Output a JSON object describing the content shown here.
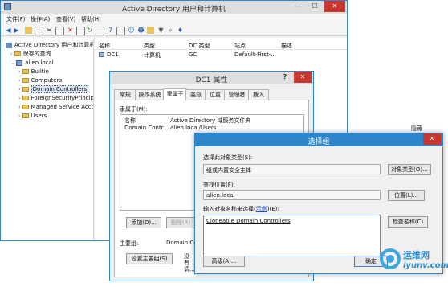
{
  "main": {
    "title": "Active Directory 用户和计算机",
    "menu": [
      "文件(F)",
      "操作(A)",
      "查看(V)",
      "帮助(H)"
    ],
    "tree": {
      "root": "Active Directory 用户和计算机",
      "saved": "保存的查询",
      "domain": "alien.local",
      "children": [
        "Builtin",
        "Computers",
        "Domain Controllers",
        "ForeignSecurityPrincipa",
        "Managed Service Acco",
        "Users"
      ]
    },
    "list": {
      "headers": [
        "名称",
        "类型",
        "DC 类型",
        "站点",
        "描述"
      ],
      "rows": [
        [
          "DC1",
          "计算机",
          "GC",
          "Default-First-...",
          ""
        ]
      ]
    },
    "side_text": "隐藏"
  },
  "props": {
    "title": "DC1 属性",
    "help": "?",
    "tabs": [
      "常规",
      "操作系统",
      "隶属于",
      "委派",
      "位置",
      "管理者",
      "拨入"
    ],
    "member_of_label": "隶属于(M):",
    "table_headers": [
      "名称",
      "Active Directory 域服务文件夹"
    ],
    "table_rows": [
      [
        "Domain Contr...",
        "alien.local/Users"
      ]
    ],
    "add_button": "添加(D)...",
    "remove_button": "删除(R)",
    "primary_group_label": "主要组:",
    "primary_group_value": "Domain Co",
    "set_primary_button": "设置主要组(S)",
    "note_text": "没有... 调... 的..."
  },
  "select": {
    "title": "选择组",
    "object_type_label": "选择此对象类型(S):",
    "object_type_value": "组或内置安全主体",
    "object_type_button": "对象类型(O)...",
    "location_label": "查找位置(F):",
    "location_value": "alien.local",
    "location_button": "位置(L)...",
    "names_label_pre": "输入对象名称来选择(",
    "names_label_link": "示例",
    "names_label_post": ")(E):",
    "names_value": "Cloneable Domain Controllers",
    "check_names_button": "检查名称(C)",
    "advanced_button": "高级(A)...",
    "ok_button": "确定",
    "close": "✕"
  },
  "watermark": {
    "cn": "运维网",
    "url": "iyunv.com"
  }
}
